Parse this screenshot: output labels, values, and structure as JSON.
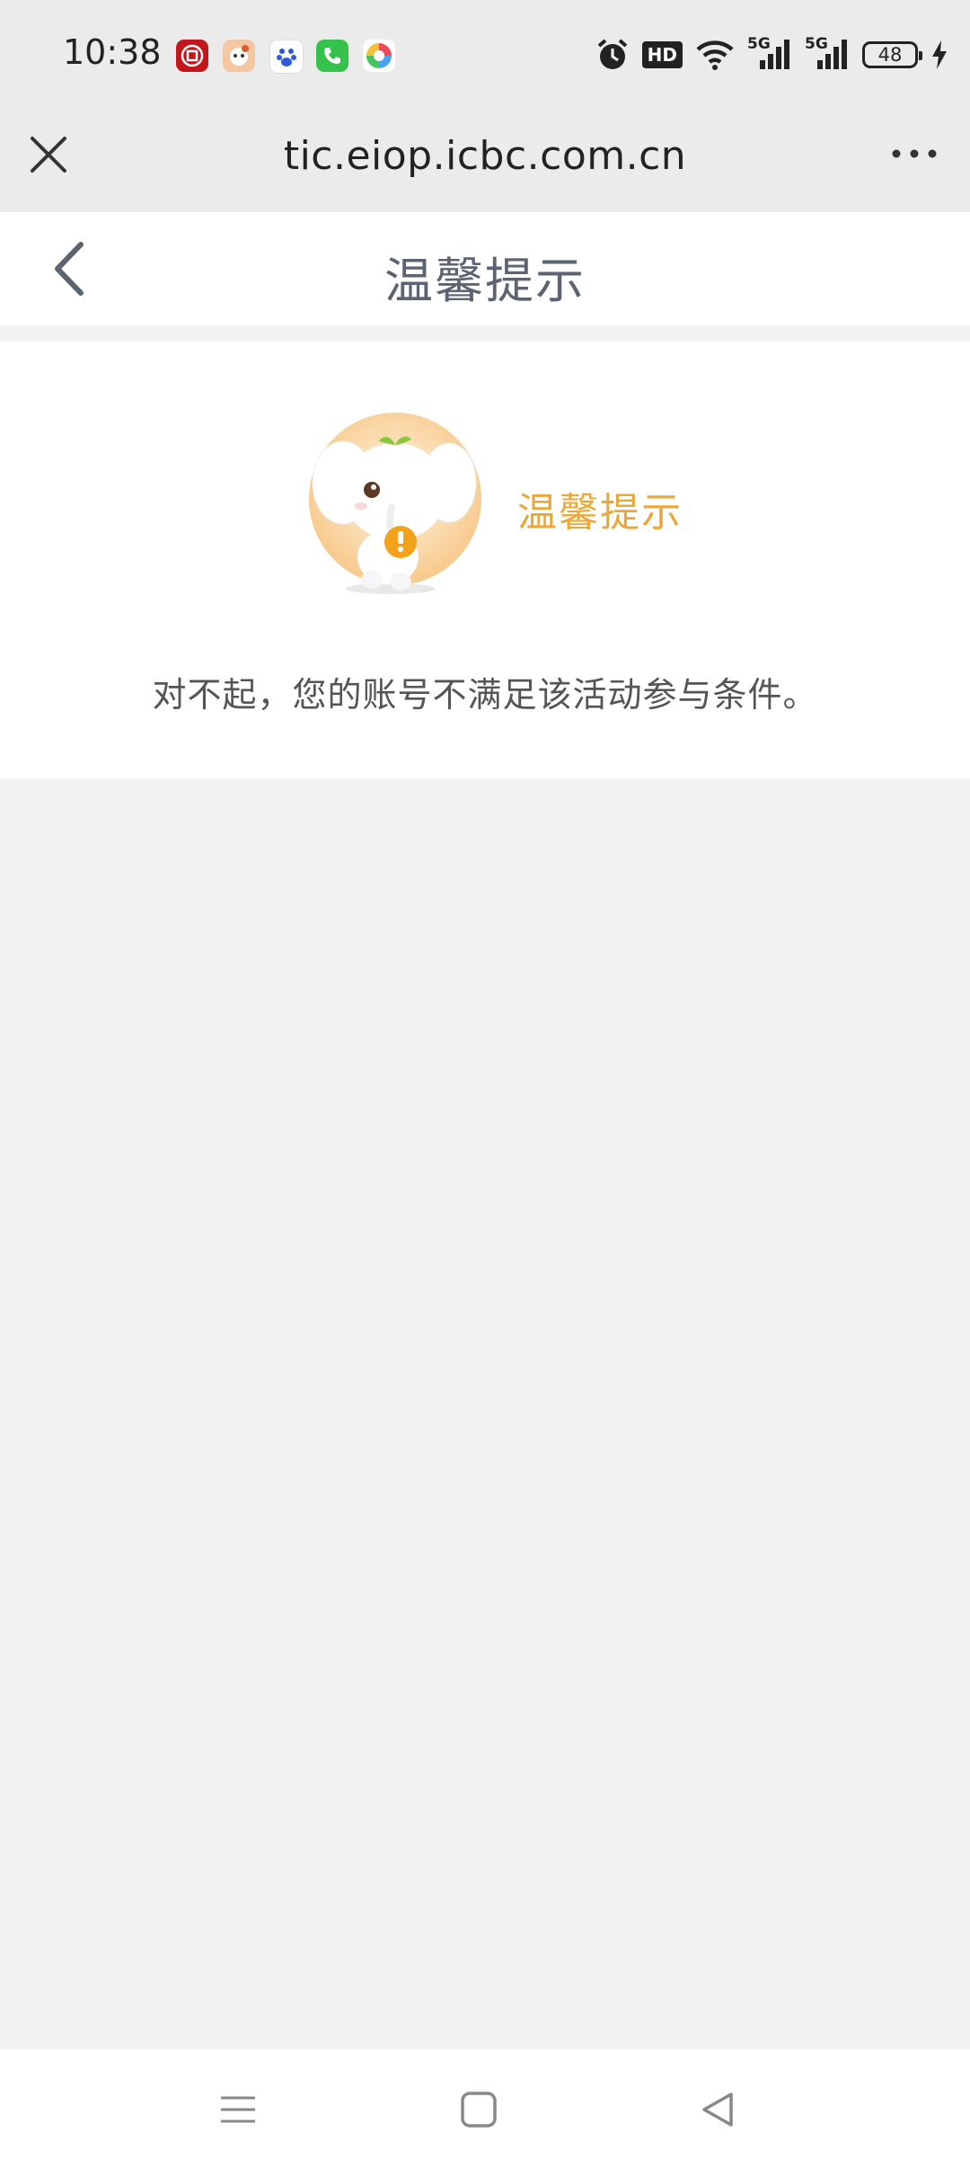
{
  "status_bar": {
    "time": "10:38",
    "notification_icons": [
      "icbc-app-icon",
      "mascot-app-icon",
      "baidu-app-icon",
      "phone-app-icon",
      "colorful-app-icon"
    ],
    "status_icons": [
      "alarm-icon",
      "hd-icon",
      "wifi-icon",
      "5g-signal-icon",
      "5g-signal-icon"
    ],
    "hd_text": "HD",
    "signal_text": "5G",
    "battery_level": "48"
  },
  "browser": {
    "url": "tic.eiop.icbc.com.cn",
    "close_icon": "close-icon",
    "menu_icon": "more-icon"
  },
  "page": {
    "title": "温馨提示",
    "back_icon": "chevron-left-icon"
  },
  "notice": {
    "label": "温馨提示",
    "message": "对不起，您的账号不满足该活动参与条件。",
    "accent_color": "#e9a93a"
  },
  "nav_bar": {
    "icons": [
      "menu-icon",
      "home-icon",
      "back-icon"
    ]
  }
}
